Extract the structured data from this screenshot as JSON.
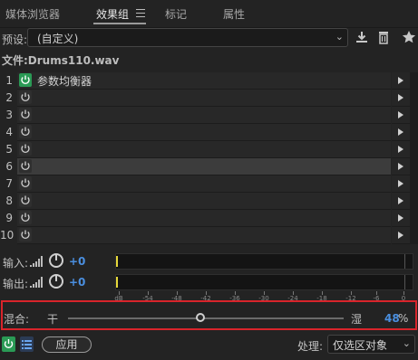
{
  "tabs": [
    {
      "label": "媒体浏览器",
      "active": false
    },
    {
      "label": "效果组",
      "active": true
    },
    {
      "label": "标记",
      "active": false
    },
    {
      "label": "属性",
      "active": false
    }
  ],
  "preset": {
    "label": "预设:",
    "value": "(自定义)"
  },
  "file": {
    "label": "文件:Drums110.wav"
  },
  "rack": {
    "slots": [
      {
        "num": "1",
        "name": "参数均衡器",
        "on": true
      },
      {
        "num": "2",
        "name": "",
        "on": false
      },
      {
        "num": "3",
        "name": "",
        "on": false
      },
      {
        "num": "4",
        "name": "",
        "on": false
      },
      {
        "num": "5",
        "name": "",
        "on": false
      },
      {
        "num": "6",
        "name": "",
        "on": false,
        "selected": true
      },
      {
        "num": "7",
        "name": "",
        "on": false
      },
      {
        "num": "8",
        "name": "",
        "on": false
      },
      {
        "num": "9",
        "name": "",
        "on": false
      },
      {
        "num": "10",
        "name": "",
        "on": false
      }
    ]
  },
  "io": {
    "input_label": "输入:",
    "input_value": "+0",
    "output_label": "输出:",
    "output_value": "+0"
  },
  "meter_scale": [
    "dB",
    "-54",
    "-48",
    "-42",
    "-36",
    "-30",
    "-24",
    "-18",
    "-12",
    "-6",
    "0"
  ],
  "mix": {
    "label": "混合:",
    "dry_label": "干",
    "wet_label": "湿",
    "value": "48",
    "unit": "%",
    "level": 0.48
  },
  "bottom": {
    "apply_label": "应用",
    "process_label": "处理:",
    "process_value": "仅选区对象"
  },
  "colors": {
    "power_on": "#2a9a55",
    "accent_blue": "#4a8fe0",
    "highlight_red": "#d9242b",
    "meter_marker": "#e6d83a"
  }
}
